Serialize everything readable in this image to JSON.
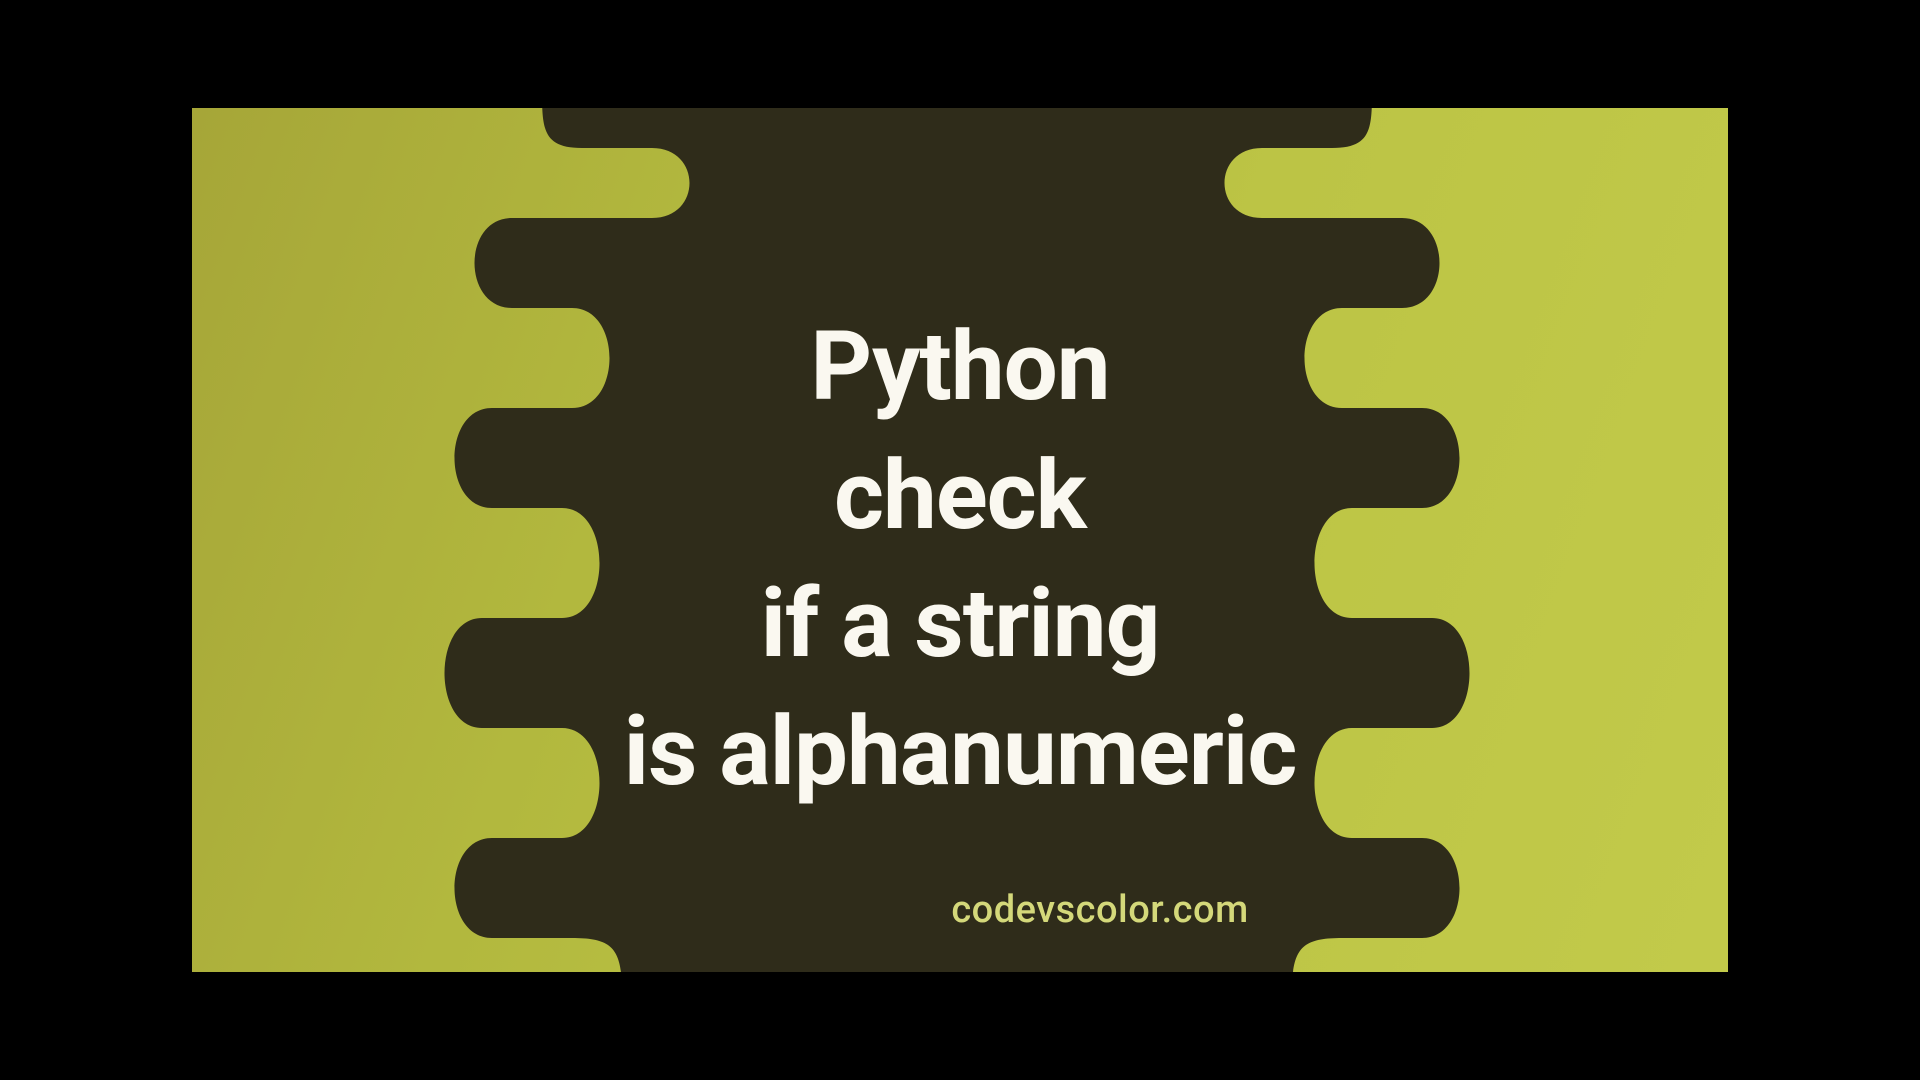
{
  "title": {
    "line1": "Python",
    "line2": "check",
    "line3": "if a string",
    "line4": "is alphanumeric"
  },
  "footer": {
    "credit": "codevscolor.com"
  },
  "colors": {
    "blob_fill": "#2f2c1a",
    "bg_start": "#a6a638",
    "bg_end": "#c2ca4a",
    "title_text": "#faf8f0",
    "credit_text": "#d4d87a"
  }
}
